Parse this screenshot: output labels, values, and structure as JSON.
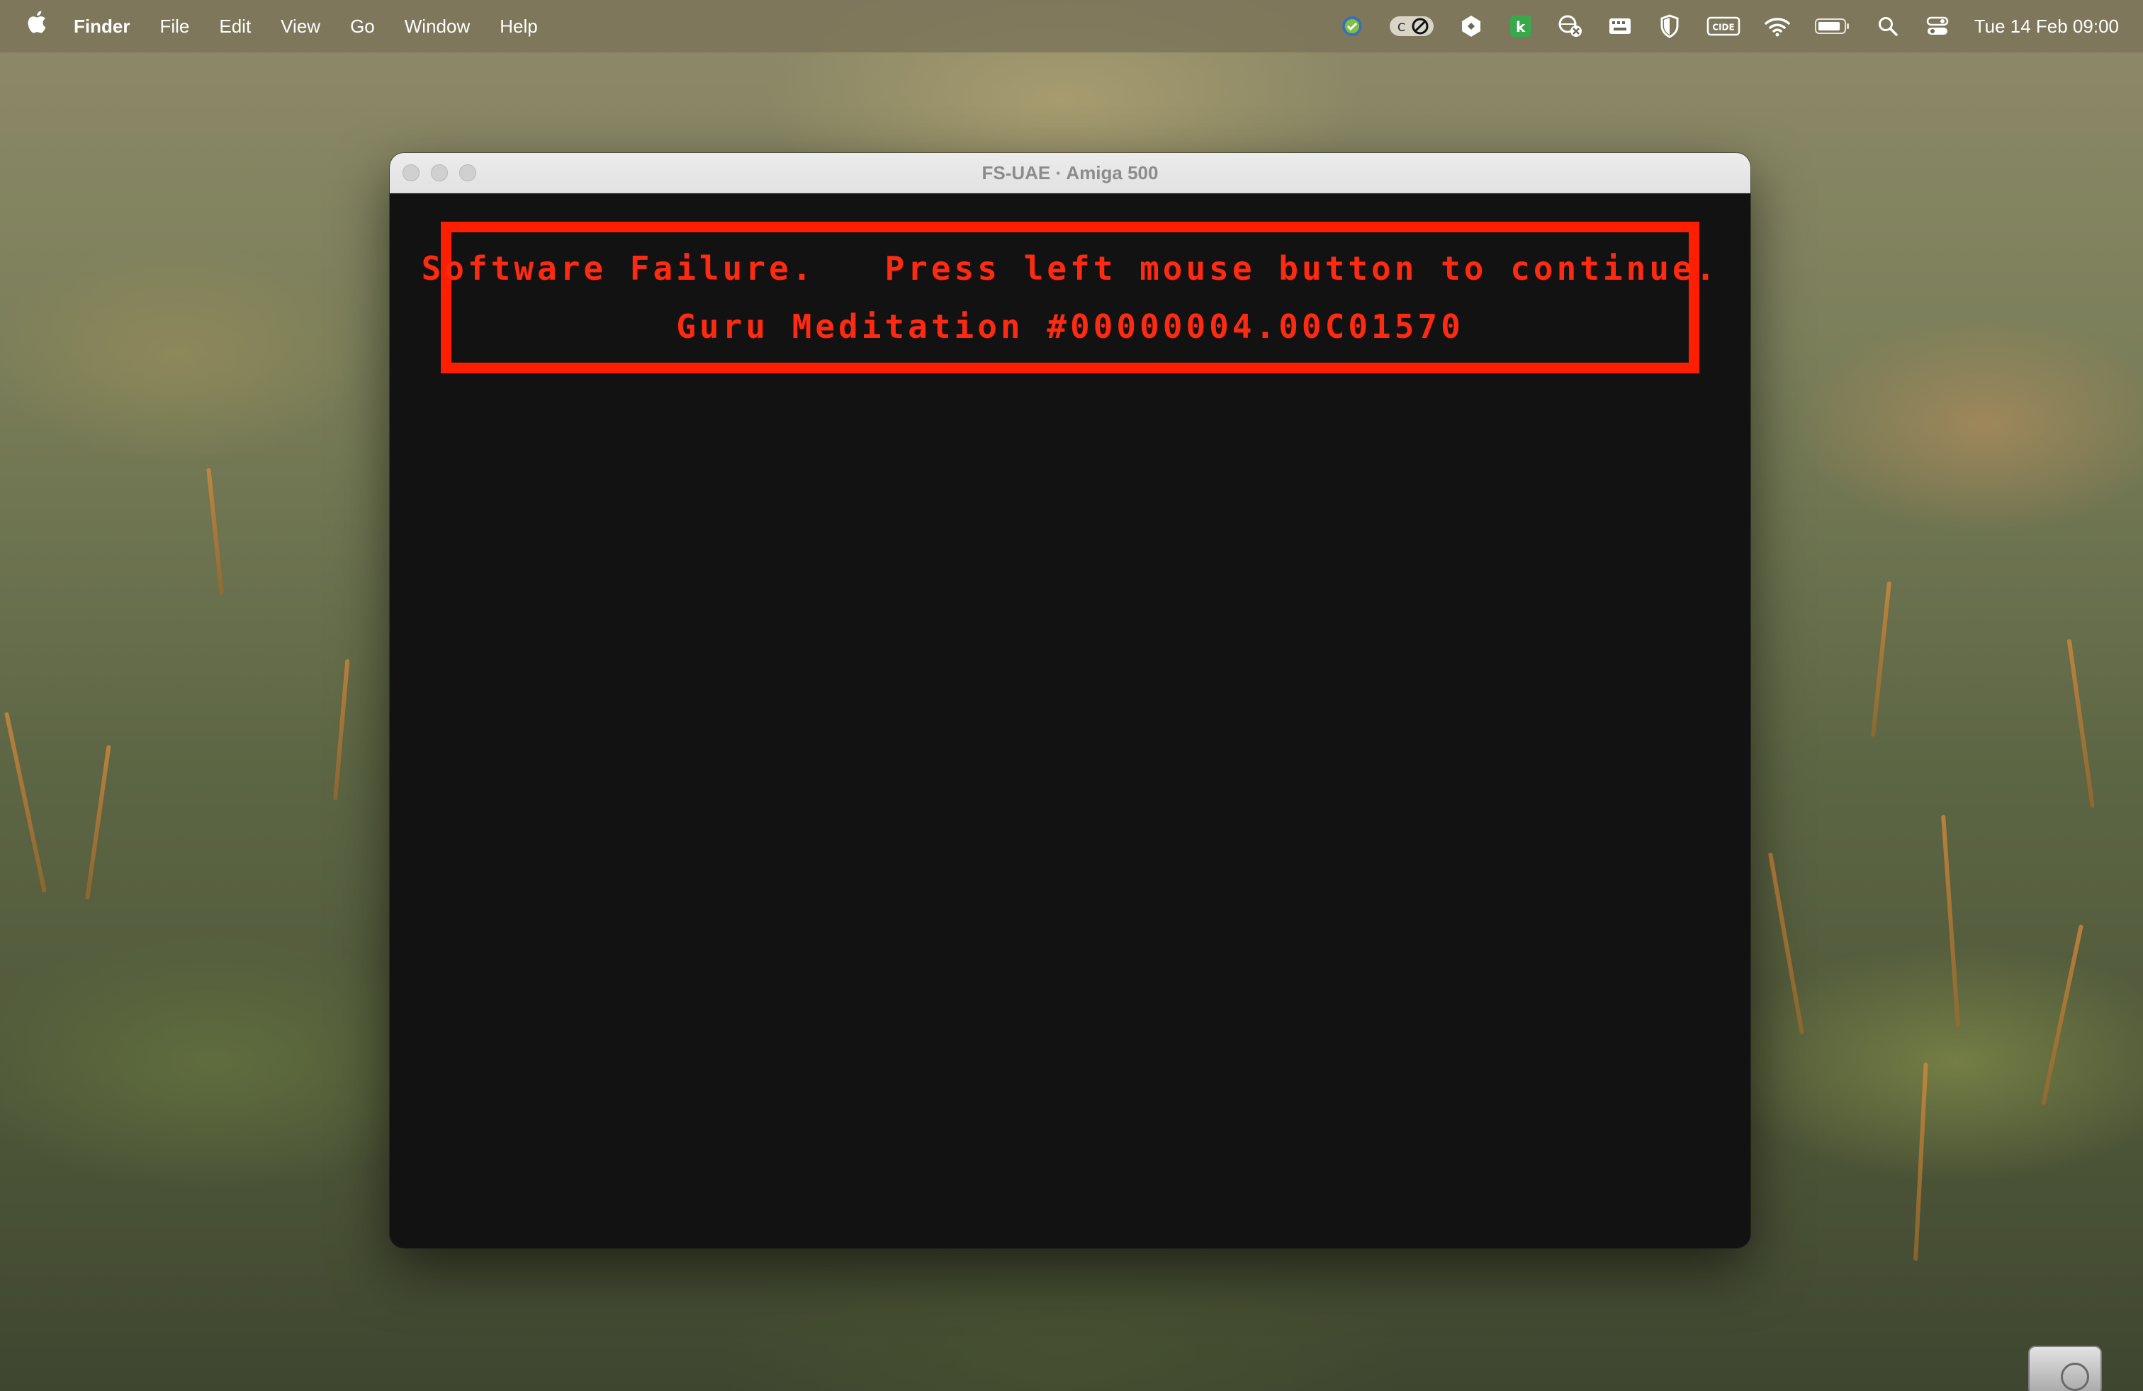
{
  "menubar": {
    "apple_icon": "apple-icon",
    "app_name": "Finder",
    "items": [
      "File",
      "Edit",
      "View",
      "Go",
      "Window",
      "Help"
    ],
    "status_icons": [
      "security-check-icon",
      "caffeine-blocker-icon",
      "dev-tool-icon",
      "k-app-icon",
      "network-toggle-icon",
      "keyboard-icon",
      "shield-icon",
      "cide-icon",
      "wifi-icon",
      "battery-icon",
      "spotlight-search-icon",
      "control-center-icon"
    ],
    "cide_label": "CIDE",
    "clock": "Tue 14 Feb  09:00"
  },
  "window": {
    "title": "FS-UAE · Amiga 500",
    "guru": {
      "line1": "Software Failure.   Press left mouse button to continue.",
      "line2": "Guru Meditation #00000004.00C01570",
      "color": "#ff1e00"
    }
  },
  "desktop": {
    "disk_icon": "hard-drive-icon"
  }
}
